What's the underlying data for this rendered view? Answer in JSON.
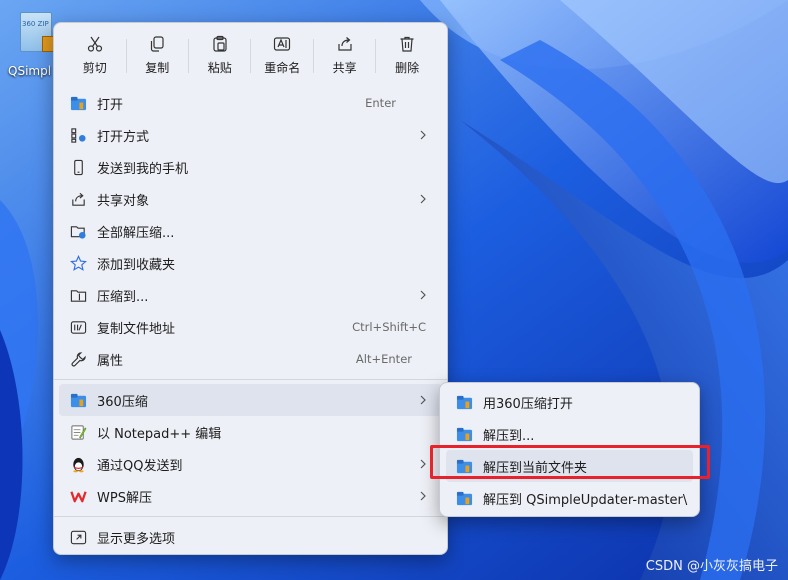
{
  "desktop": {
    "icon_label": "QSimpl",
    "icon_badge_text": "360 ZIP"
  },
  "toolbar": [
    {
      "label": "剪切",
      "icon": "cut-icon"
    },
    {
      "label": "复制",
      "icon": "copy-icon"
    },
    {
      "label": "粘贴",
      "icon": "paste-icon"
    },
    {
      "label": "重命名",
      "icon": "rename-icon"
    },
    {
      "label": "共享",
      "icon": "share-icon"
    },
    {
      "label": "删除",
      "icon": "delete-icon"
    }
  ],
  "menu": {
    "open": {
      "label": "打开",
      "shortcut": "Enter"
    },
    "open_with": {
      "label": "打开方式"
    },
    "send_to_phone": {
      "label": "发送到我的手机"
    },
    "share_with": {
      "label": "共享对象"
    },
    "extract_all": {
      "label": "全部解压缩..."
    },
    "add_favorites": {
      "label": "添加到收藏夹"
    },
    "compress_to": {
      "label": "压缩到..."
    },
    "copy_path": {
      "label": "复制文件地址",
      "shortcut": "Ctrl+Shift+C"
    },
    "properties": {
      "label": "属性",
      "shortcut": "Alt+Enter"
    },
    "zip360": {
      "label": "360压缩"
    },
    "notepadpp": {
      "label": "以 Notepad++ 编辑"
    },
    "send_qq": {
      "label": "通过QQ发送到"
    },
    "wps_extract": {
      "label": "WPS解压"
    },
    "more_options": {
      "label": "显示更多选项"
    }
  },
  "submenu": {
    "items": [
      {
        "label": "用360压缩打开"
      },
      {
        "label": "解压到..."
      },
      {
        "label": "解压到当前文件夹"
      },
      {
        "label": "解压到 QSimpleUpdater-master\\"
      }
    ]
  },
  "watermark": "CSDN @小灰灰搞电子",
  "colors": {
    "highlight_box": "#e8222a",
    "menu_bg": "#eef0f7",
    "wallpaper": "#1a55d8"
  }
}
